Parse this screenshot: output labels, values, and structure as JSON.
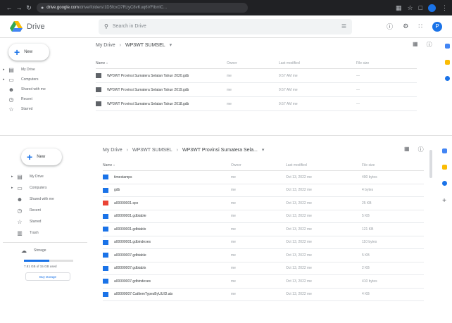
{
  "browser": {
    "url": "drive.google.com",
    "url_tail": "/drive/folders/1D5fcxO7RzyC8vKuq6VFIbrrlC...",
    "icons": [
      "extensions-icon",
      "star-icon",
      "tab-icon",
      "menu-icon"
    ]
  },
  "app": {
    "name": "Drive",
    "search_placeholder": "Search in Drive",
    "avatar_letter": "P"
  },
  "top_window": {
    "new_label": "New",
    "nav": [
      {
        "label": "My Drive",
        "icon": "drive-icon"
      },
      {
        "label": "Computers",
        "icon": "computer-icon"
      },
      {
        "label": "Shared with me",
        "icon": "people-icon"
      },
      {
        "label": "Recent",
        "icon": "clock-icon"
      },
      {
        "label": "Starred",
        "icon": "star-icon"
      }
    ],
    "breadcrumb": [
      "My Drive",
      "WP3WT SUMSEL"
    ],
    "columns": {
      "name": "Name",
      "owner": "Owner",
      "modified": "Last modified",
      "size": "File size"
    },
    "rows": [
      {
        "name": "WP3WT Provinsi Sumatera Selatan Tahun 2020.gdb",
        "owner": "me",
        "modified": "9:57 AM me",
        "size": "—"
      },
      {
        "name": "WP3WT Provinsi Sumatera Selatan Tahun 2019.gdb",
        "owner": "me",
        "modified": "9:57 AM me",
        "size": "—"
      },
      {
        "name": "WP3WT Provinsi Sumatera Selatan Tahun 2018.gdb",
        "owner": "me",
        "modified": "9:57 AM me",
        "size": "—"
      }
    ]
  },
  "bottom_window": {
    "new_label": "New",
    "nav": [
      {
        "label": "My Drive",
        "icon": "drive-icon"
      },
      {
        "label": "Computers",
        "icon": "computer-icon"
      },
      {
        "label": "Shared with me",
        "icon": "people-icon"
      },
      {
        "label": "Recent",
        "icon": "clock-icon"
      },
      {
        "label": "Starred",
        "icon": "star-icon"
      },
      {
        "label": "Trash",
        "icon": "trash-icon"
      }
    ],
    "storage_label": "Storage",
    "storage_text": "7.81 GB of 15 GB used",
    "storage_fraction": 0.52,
    "buy_storage": "Buy storage",
    "breadcrumb": [
      "My Drive",
      "WP3WT SUMSEL",
      "WP3WT Provinsi Sumatera Sela..."
    ],
    "columns": {
      "name": "Name",
      "owner": "Owner",
      "modified": "Last modified",
      "size": "File size"
    },
    "rows": [
      {
        "name": "timestamps",
        "type": "folder",
        "owner": "me",
        "modified": "Oct 13, 2022 me",
        "size": "490 bytes"
      },
      {
        "name": "gdb",
        "type": "file",
        "owner": "me",
        "modified": "Oct 13, 2022 me",
        "size": "4 bytes"
      },
      {
        "name": "a00000001.spx",
        "type": "red",
        "owner": "me",
        "modified": "Oct 13, 2022 me",
        "size": "25 KB"
      },
      {
        "name": "a00000001.gdbtable",
        "type": "file",
        "owner": "me",
        "modified": "Oct 13, 2022 me",
        "size": "5 KB"
      },
      {
        "name": "a00000001.gdbtablx",
        "type": "file",
        "owner": "me",
        "modified": "Oct 13, 2022 me",
        "size": "121 KB"
      },
      {
        "name": "a00000001.gdbindexes",
        "type": "file",
        "owner": "me",
        "modified": "Oct 13, 2022 me",
        "size": "110 bytes"
      },
      {
        "name": "a00000007.gdbtable",
        "type": "file",
        "owner": "me",
        "modified": "Oct 13, 2022 me",
        "size": "5 KB"
      },
      {
        "name": "a00000007.gdbtablx",
        "type": "file",
        "owner": "me",
        "modified": "Oct 13, 2022 me",
        "size": "2 KB"
      },
      {
        "name": "a00000007.gdbindexes",
        "type": "file",
        "owner": "me",
        "modified": "Oct 13, 2022 me",
        "size": "410 bytes"
      },
      {
        "name": "a00000007.CatItemTypesByUUID.atx",
        "type": "file",
        "owner": "me",
        "modified": "Oct 13, 2022 me",
        "size": "4 KB"
      }
    ]
  },
  "colors": {
    "accent": "#1a73e8",
    "folder": "#5f6368",
    "file": "#1a73e8",
    "red": "#ea4335",
    "yellow": "#fbbc04"
  }
}
